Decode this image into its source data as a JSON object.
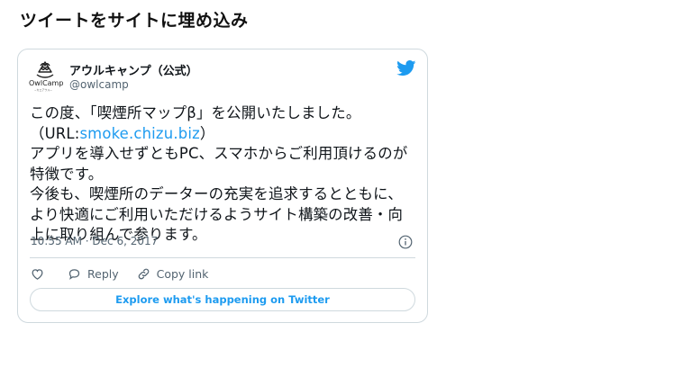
{
  "page": {
    "heading": "ツイートをサイトに埋め込み"
  },
  "tweet": {
    "avatar": {
      "logo_text": "OwlCamp",
      "sub_text": "~カエアウル~"
    },
    "display_name": "アウルキャンプ（公式）",
    "handle": "@owlcamp",
    "body": {
      "line1": "この度、「喫煙所マップβ」を公開いたしました。",
      "line2_prefix": "（URL:",
      "line2_link": "smoke.chizu.biz",
      "line2_suffix": "）",
      "line3": "アプリを導入せずともPC、スマホからご利用頂けるのが",
      "line4": "特徴です。",
      "line5": "今後も、喫煙所のデーターの充実を追求するとともに、",
      "line6": "より快適にご利用いただけるようサイト構築の改善・向",
      "line7": "上に取り組んで参ります。"
    },
    "timestamp": "10:55 AM · Dec 6, 2017",
    "actions": {
      "reply": "Reply",
      "copy_link": "Copy link"
    },
    "explore_label": "Explore what's happening on Twitter"
  },
  "colors": {
    "twitter_blue": "#1d9bf0",
    "text": "#0f1419",
    "secondary": "#536471",
    "border": "#cfd9de"
  }
}
